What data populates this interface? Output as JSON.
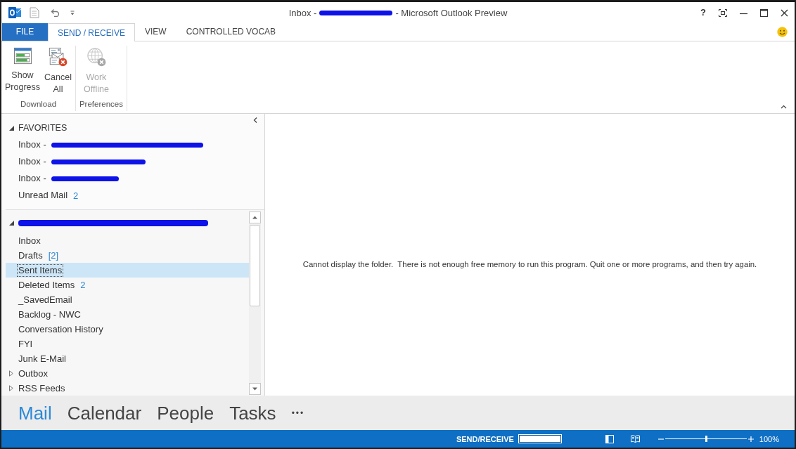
{
  "title_bar": {
    "title_start": "Inbox -",
    "title_redacted": true,
    "title_end": "- Microsoft Outlook Preview",
    "help": "?"
  },
  "ribbon_tabs": [
    {
      "label": "FILE",
      "kind": "file",
      "selected": false
    },
    {
      "label": "SEND / RECEIVE",
      "kind": "tab",
      "selected": true
    },
    {
      "label": "VIEW",
      "kind": "tab",
      "selected": false
    },
    {
      "label": "CONTROLLED VOCAB",
      "kind": "tab",
      "selected": false
    }
  ],
  "ribbon_groups": [
    {
      "label": "Download",
      "buttons": [
        {
          "label": "Show Progress",
          "kind": "progress",
          "disabled": false
        },
        {
          "label": "Cancel All",
          "kind": "cancel",
          "disabled": false
        }
      ]
    },
    {
      "label": "Preferences",
      "buttons": [
        {
          "label": "Work Offline",
          "kind": "offline",
          "disabled": true
        }
      ]
    }
  ],
  "favorites": {
    "header": "FAVORITES",
    "expanded": true,
    "items": [
      {
        "label": "Inbox -",
        "redacted": true,
        "selected": false
      },
      {
        "label": "Inbox -",
        "redacted": true,
        "selected": false
      },
      {
        "label": "Inbox -",
        "redacted": true,
        "selected": false
      },
      {
        "label": "Unread Mail",
        "count": "2",
        "redacted": false,
        "selected": false
      }
    ]
  },
  "mailbox": {
    "redacted": true,
    "expanded": true,
    "folders": [
      {
        "label": "Inbox",
        "expandable": false,
        "selected": false
      },
      {
        "label": "Drafts",
        "count": "[2]",
        "expandable": false,
        "selected": false
      },
      {
        "label": "Sent Items",
        "expandable": false,
        "selected": true
      },
      {
        "label": "Deleted Items",
        "count": "2",
        "expandable": false,
        "selected": false
      },
      {
        "label": "_SavedEmail",
        "expandable": false,
        "selected": false
      },
      {
        "label": "Backlog - NWC",
        "expandable": false,
        "selected": false
      },
      {
        "label": "Conversation History",
        "expandable": false,
        "selected": false
      },
      {
        "label": "FYI",
        "expandable": false,
        "selected": false
      },
      {
        "label": "Junk E-Mail",
        "expandable": false,
        "selected": false
      },
      {
        "label": "Outbox",
        "expandable": true,
        "selected": false
      },
      {
        "label": "RSS Feeds",
        "expandable": true,
        "selected": false
      }
    ]
  },
  "reading_pane": {
    "message": "Cannot display the folder.  There is not enough free memory to run this program. Quit one or more programs, and then try again."
  },
  "navigation": {
    "items": [
      {
        "label": "Mail",
        "selected": true
      },
      {
        "label": "Calendar",
        "selected": false
      },
      {
        "label": "People",
        "selected": false
      },
      {
        "label": "Tasks",
        "selected": false
      }
    ],
    "more": "•••"
  },
  "status_bar": {
    "label": "SEND/RECEIVE",
    "progress": {
      "level": 1
    },
    "zoom": {
      "level": 0.5,
      "text": "100%"
    }
  }
}
